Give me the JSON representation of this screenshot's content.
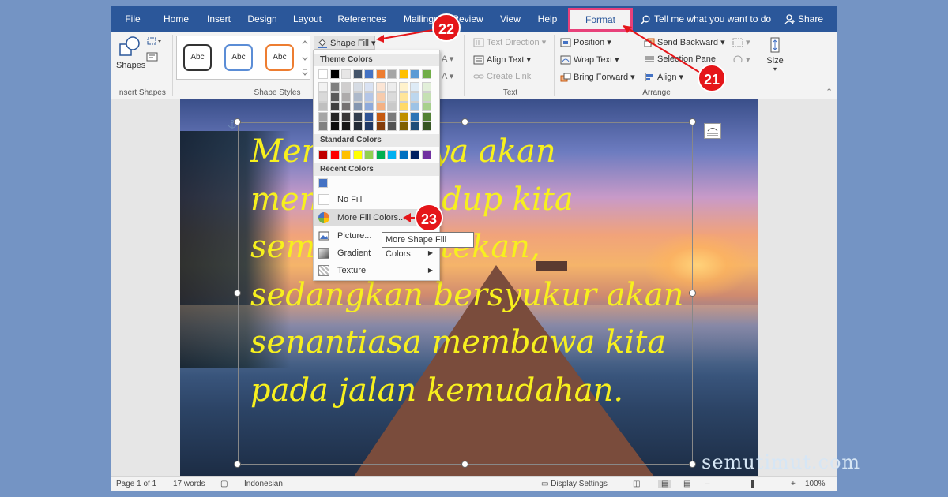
{
  "tabs": [
    "File",
    "Home",
    "Insert",
    "Design",
    "Layout",
    "References",
    "Mailings",
    "Review",
    "View",
    "Help"
  ],
  "active_tab": "Format",
  "tell_me": "Tell me what you want to do",
  "share": "Share",
  "ribbon": {
    "insert_shapes": {
      "shapes_label": "Shapes",
      "group_label": "Insert Shapes"
    },
    "shape_styles": {
      "samples": [
        "Abc",
        "Abc",
        "Abc"
      ],
      "shape_fill": "Shape Fill",
      "group_label": "Shape Styles"
    },
    "text": {
      "text_direction": "Text Direction",
      "align_text": "Align Text",
      "create_link": "Create Link",
      "group_label": "Text"
    },
    "arrange": {
      "position": "Position",
      "wrap_text": "Wrap Text",
      "bring_forward": "Bring Forward",
      "send_backward": "Send Backward",
      "selection_pane": "Selection Pane",
      "align": "Align",
      "group_label": "Arrange"
    },
    "size": {
      "label": "Size"
    }
  },
  "dropdown": {
    "theme_colors_title": "Theme Colors",
    "theme_top": [
      "#ffffff",
      "#000000",
      "#e7e6e6",
      "#44546a",
      "#4472c4",
      "#ed7d31",
      "#a5a5a5",
      "#ffc000",
      "#5b9bd5",
      "#70ad47"
    ],
    "theme_columns": [
      [
        "#f2f2f2",
        "#d9d9d9",
        "#bfbfbf",
        "#a6a6a6",
        "#808080"
      ],
      [
        "#7f7f7f",
        "#595959",
        "#404040",
        "#262626",
        "#0d0d0d"
      ],
      [
        "#d0cece",
        "#aeabab",
        "#757171",
        "#3a3838",
        "#171616"
      ],
      [
        "#d6dce4",
        "#adb9ca",
        "#8496b0",
        "#333f4f",
        "#222a35"
      ],
      [
        "#d9e2f3",
        "#b4c6e7",
        "#8eaadb",
        "#2f5496",
        "#1f3864"
      ],
      [
        "#fbe5d5",
        "#f7cbac",
        "#f4b183",
        "#c55a11",
        "#833c0b"
      ],
      [
        "#ededed",
        "#dbdbdb",
        "#c9c9c9",
        "#7b7b7b",
        "#525252"
      ],
      [
        "#fff2cc",
        "#ffe599",
        "#ffd966",
        "#bf9000",
        "#7f6000"
      ],
      [
        "#deebf6",
        "#bdd7ee",
        "#9dc3e6",
        "#2e75b5",
        "#1f4e79"
      ],
      [
        "#e2efd9",
        "#c5e0b3",
        "#a8d08d",
        "#538135",
        "#375623"
      ]
    ],
    "standard_colors_title": "Standard Colors",
    "standard": [
      "#c00000",
      "#ff0000",
      "#ffc000",
      "#ffff00",
      "#92d050",
      "#00b050",
      "#00b0f0",
      "#0070c0",
      "#002060",
      "#7030a0"
    ],
    "recent_colors_title": "Recent Colors",
    "recent": [
      "#4472c4"
    ],
    "no_fill": "No Fill",
    "more_fill_colors": "More Fill Colors...",
    "picture": "Picture...",
    "gradient": "Gradient",
    "texture": "Texture"
  },
  "tooltip": "More Shape Fill Colors",
  "callouts": [
    "21",
    "22",
    "23"
  ],
  "document": {
    "quote_lines": [
      "Mengeluhnya akan",
      "membuat hidup kita",
      "semakin tertekan,",
      "sedangkan bersyukur akan",
      "senantiasa membawa kita",
      "pada jalan kemudahan."
    ]
  },
  "status": {
    "page": "Page 1 of 1",
    "words": "17 words",
    "language": "Indonesian",
    "display": "Display Settings",
    "zoom": "100%"
  },
  "watermark": "semutimut.com"
}
